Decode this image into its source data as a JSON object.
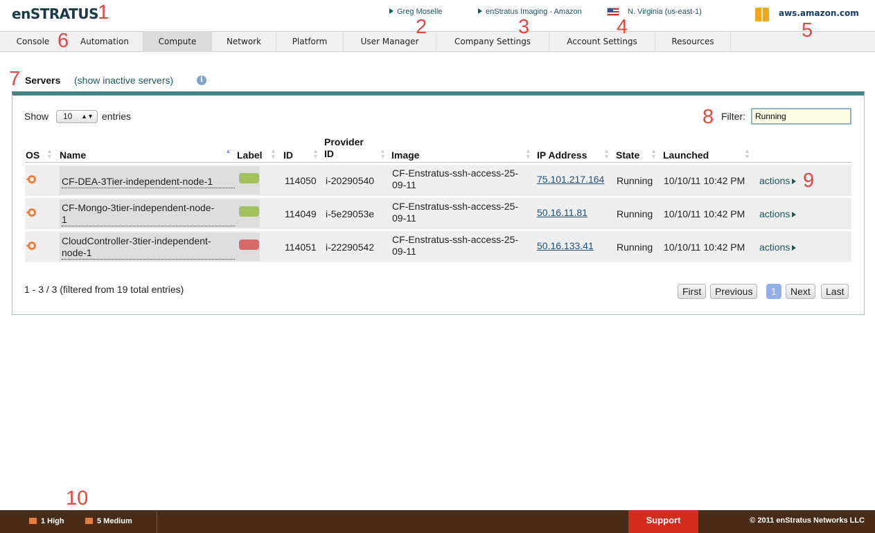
{
  "header": {
    "logo_prefix": "en",
    "logo_suffix": "STRATUS",
    "user": "Greg Moselle",
    "account": "enStratus Imaging - Amazon",
    "region": "N. Virginia (us-east-1)",
    "provider": "aws.amazon.com"
  },
  "nav": {
    "items": [
      "Console",
      "Automation",
      "Compute",
      "Network",
      "Platform",
      "User Manager",
      "Company Settings",
      "Account Settings",
      "Resources"
    ],
    "active": "Compute"
  },
  "section": {
    "title": "Servers",
    "inactive_link": "(show inactive servers)",
    "info_icon": "i"
  },
  "table_controls": {
    "show_label": "Show",
    "show_value": "10",
    "entries_label": "entries",
    "filter_label": "Filter:",
    "filter_value": "Running"
  },
  "columns": [
    "OS",
    "Name",
    "Label",
    "ID",
    "Provider ID",
    "Image",
    "IP Address",
    "State",
    "Launched"
  ],
  "rows": [
    {
      "os_icon": "ubuntu-icon",
      "name_line1": "CF-DEA-3Tier-independent-node-1",
      "name_line2": "",
      "label_color": "#a3c15e",
      "id": "114050",
      "provider_id": "i-20290540",
      "image_line1": "CF-Enstratus-ssh-access-25-",
      "image_line2": "09-11",
      "ip": "75.101.217.164",
      "state": "Running",
      "launched": "10/10/11 10:42 PM",
      "actions": "actions"
    },
    {
      "os_icon": "ubuntu-icon",
      "name_line1": "CF-Mongo-3tier-independent-node-",
      "name_line2": "1",
      "label_color": "#a3c15e",
      "id": "114049",
      "provider_id": "i-5e29053e",
      "image_line1": "CF-Enstratus-ssh-access-25-",
      "image_line2": "09-11",
      "ip": "50.16.11.81",
      "state": "Running",
      "launched": "10/10/11 10:42 PM",
      "actions": "actions"
    },
    {
      "os_icon": "ubuntu-icon",
      "name_line1": "CloudController-3tier-independent-",
      "name_line2": "node-1",
      "label_color": "#d9686a",
      "id": "114051",
      "provider_id": "i-22290542",
      "image_line1": "CF-Enstratus-ssh-access-25-",
      "image_line2": "09-11",
      "ip": "50.16.133.41",
      "state": "Running",
      "launched": "10/10/11 10:42 PM",
      "actions": "actions"
    }
  ],
  "pagination": {
    "info": "1 - 3 / 3 (filtered from 19 total entries)",
    "first": "First",
    "previous": "Previous",
    "current": "1",
    "next": "Next",
    "last": "Last"
  },
  "footer": {
    "alert_high": "1 High",
    "alert_medium": "5 Medium",
    "support": "Support",
    "copyright": "© 2011 enStratus Networks LLC"
  },
  "annotations": [
    "1",
    "2",
    "3",
    "4",
    "5",
    "6",
    "7",
    "8",
    "9",
    "10"
  ]
}
